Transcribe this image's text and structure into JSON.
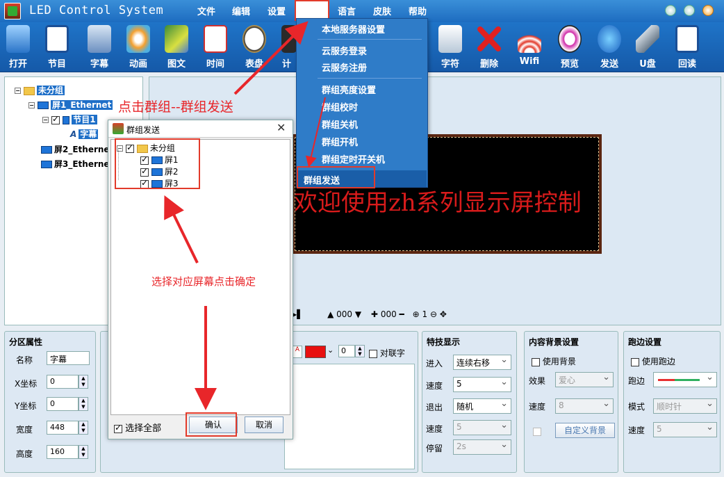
{
  "window": {
    "title": "LED Control System"
  },
  "menu": [
    "文件",
    "编辑",
    "设置",
    "语言",
    "皮肤",
    "帮助"
  ],
  "toolbar": [
    {
      "label": "打开",
      "icon": "folder-open-icon"
    },
    {
      "label": "节目",
      "icon": "program-icon"
    },
    {
      "label": "字幕",
      "icon": "subtitle-icon"
    },
    {
      "label": "动画",
      "icon": "animation-icon"
    },
    {
      "label": "图文",
      "icon": "image-text-icon"
    },
    {
      "label": "时间",
      "icon": "calendar-icon"
    },
    {
      "label": "表盘",
      "icon": "clock-icon"
    },
    {
      "label": "计",
      "icon": "timer-icon"
    },
    {
      "label": "字符",
      "icon": "character-icon"
    },
    {
      "label": "删除",
      "icon": "delete-icon"
    },
    {
      "label": "Wifi",
      "icon": "wifi-icon"
    },
    {
      "label": "预览",
      "icon": "preview-icon"
    },
    {
      "label": "发送",
      "icon": "send-icon"
    },
    {
      "label": "U盘",
      "icon": "usb-icon"
    },
    {
      "label": "回读",
      "icon": "readback-icon"
    }
  ],
  "tree": {
    "root": "未分组",
    "screen1": "屏1_Ethernet",
    "program1": "节目1",
    "subtitle": "字幕",
    "screen2": "屏2_Etherne",
    "screen3": "屏3_Etherne"
  },
  "preview": {
    "led_text": "欢迎使用zh系列显示屏控制",
    "controls": {
      "value1": "000",
      "value2": "000",
      "zoom": "1"
    }
  },
  "dropdown": {
    "items": [
      "本地服务器设置",
      "云服务登录",
      "云服务注册",
      "群组亮度设置",
      "群组校时",
      "群组关机",
      "群组开机",
      "群组定时开关机",
      "群组发送"
    ]
  },
  "dialog": {
    "title": "群组发送",
    "tree": {
      "root": "未分组",
      "items": [
        "屏1",
        "屏2",
        "屏3"
      ]
    },
    "select_all": "选择全部",
    "ok": "确认",
    "cancel": "取消"
  },
  "annotations": {
    "top": "点击群组--群组发送",
    "middle": "选择对应屏幕点击确定"
  },
  "zone_props": {
    "title": "分区属性",
    "name_label": "名称",
    "name_value": "字幕",
    "x_label": "X坐标",
    "x_value": "0",
    "y_label": "Y坐标",
    "y_value": "0",
    "w_label": "宽度",
    "w_value": "448",
    "h_label": "高度",
    "h_value": "160"
  },
  "text_format": {
    "font_size": "0",
    "couplet_label": "对联字",
    "color": "#e81010"
  },
  "effects": {
    "title": "特技显示",
    "enter_label": "进入",
    "enter_value": "连续右移",
    "speed1_label": "速度",
    "speed1_value": "5",
    "exit_label": "退出",
    "exit_value": "随机",
    "speed2_label": "速度",
    "speed2_value": "5",
    "stay_label": "停留",
    "stay_value": "2s"
  },
  "bg": {
    "title": "内容背景设置",
    "use_bg": "使用背景",
    "effect_label": "效果",
    "effect_value": "爱心",
    "speed_label": "速度",
    "speed_value": "8",
    "custom_bg": "自定义背景"
  },
  "border": {
    "title": "跑边设置",
    "use_border": "使用跑边",
    "border_label": "跑边",
    "mode_label": "模式",
    "mode_value": "顺时针",
    "speed_label": "速度",
    "speed_value": "5"
  }
}
